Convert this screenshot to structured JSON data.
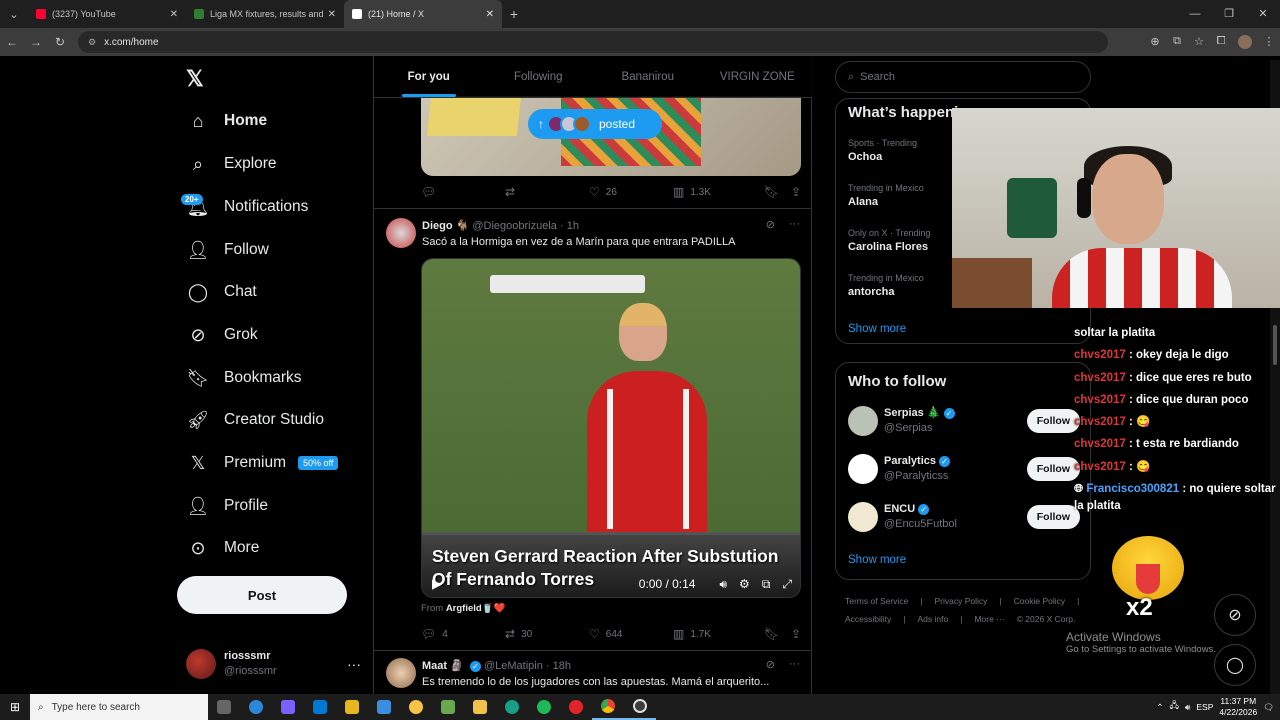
{
  "browser": {
    "tabs": [
      {
        "title": "(3237) YouTube",
        "favicon_color": "#ff0033",
        "active": false
      },
      {
        "title": "Liga MX fixtures, results and live",
        "favicon_color": "#2e7d32",
        "active": false
      },
      {
        "title": "(21) Home / X",
        "favicon_color": "#ffffff",
        "active": true
      }
    ],
    "url": "x.com/home",
    "new_tab_symbol": "+"
  },
  "nav": {
    "items": [
      {
        "label": "Home",
        "icon": "home-icon",
        "bold": true
      },
      {
        "label": "Explore",
        "icon": "search-icon"
      },
      {
        "label": "Notifications",
        "icon": "bell-icon"
      },
      {
        "label": "Follow",
        "icon": "follow-icon"
      },
      {
        "label": "Chat",
        "icon": "chat-icon"
      },
      {
        "label": "Grok",
        "icon": "grok-icon"
      },
      {
        "label": "Bookmarks",
        "icon": "bookmark-icon"
      },
      {
        "label": "Creator Studio",
        "icon": "rocket-icon"
      },
      {
        "label": "Premium",
        "icon": "x-logo-icon"
      },
      {
        "label": "Profile",
        "icon": "person-icon"
      },
      {
        "label": "More",
        "icon": "more-circle-icon"
      }
    ],
    "notifications_badge": "20+",
    "premium_badge": "50% off",
    "post_label": "Post",
    "account": {
      "name": "riosssmr",
      "handle": "@riosssmr"
    }
  },
  "timeline": {
    "tabs": [
      "For you",
      "Following",
      "Bananirou",
      "VIRGIN ZONE"
    ],
    "posted_pill": "posted",
    "tweet1": {
      "replies": "",
      "retweets": "",
      "likes": "26",
      "views": "1.3K"
    },
    "tweet2": {
      "name": "Diego 🐐",
      "handle": "@Diegoobrizuela",
      "time": "· 1h",
      "text": "Sacó a la Hormiga en vez de a Marín para que entrara PADILLA",
      "video_caption": "Steven Gerrard Reaction After Substution Of Fernando Torres",
      "video_time": "0:00 / 0:14",
      "from_label": "From",
      "from_account": "Argfield🥤❤️",
      "replies": "4",
      "retweets": "30",
      "likes": "644",
      "views": "1.7K"
    },
    "tweet3": {
      "name": "Maat 🗿",
      "handle": "@LeMatipin",
      "time": "· 18h",
      "text": "Es tremendo lo de los jugadores con las apuestas. Mamá el arquerito..."
    }
  },
  "right": {
    "search_placeholder": "Search",
    "happening_title": "What’s happening",
    "trends": [
      {
        "category": "Sports · Trending",
        "title": "Ochoa"
      },
      {
        "category": "Trending in Mexico",
        "title": "Alana"
      },
      {
        "category": "Only on X · Trending",
        "title": "Carolina Flores"
      },
      {
        "category": "Trending in Mexico",
        "title": "antorcha"
      }
    ],
    "show_more": "Show more",
    "who_to_follow_title": "Who to follow",
    "who_to_follow": [
      {
        "name": "Serpias 🎄",
        "handle": "@Serpias",
        "avatar_color": "#b9c2b4"
      },
      {
        "name": "Paralytics",
        "handle": "@Paralyticss",
        "avatar_color": "#ffffff"
      },
      {
        "name": "ENCU",
        "handle": "@Encu5Futbol",
        "avatar_color": "#f0e8d0"
      }
    ],
    "follow_label": "Follow",
    "footer": [
      "Terms of Service",
      "|",
      "Privacy Policy",
      "|",
      "Cookie Policy",
      "|",
      "Accessibility",
      "|",
      "Ads info",
      "|",
      "More ···",
      "© 2026 X Corp."
    ]
  },
  "overlay": {
    "chat": [
      {
        "user": "",
        "msg": "soltar la platita"
      },
      {
        "user": "chvs2017",
        "msg": ": okey deja le digo"
      },
      {
        "user": "chvs2017",
        "msg": ": dice que eres re buto"
      },
      {
        "user": "chvs2017",
        "msg": ": dice que duran poco"
      },
      {
        "user": "chvs2017",
        "msg": ": 😋"
      },
      {
        "user": "chvs2017",
        "msg": ": t esta re bardiando"
      },
      {
        "user": "chvs2017",
        "msg": ": 😋"
      },
      {
        "user": "Francisco300821",
        "msg": ": no quiere soltar la platita",
        "alt": true
      }
    ],
    "emoji_multiplier": "x2",
    "activate_line1": "Activate Windows",
    "activate_line2": "Go to Settings to activate Windows."
  },
  "taskbar": {
    "search_placeholder": "Type here to search",
    "language": "ESP",
    "time": "11:37 PM",
    "date": "4/22/2026",
    "apps": [
      "#2b88d8",
      "#0f9d58",
      "#e6b81f",
      "#0078d4",
      "#107c10",
      "#5c6bc0",
      "#6aa84f",
      "#f6c343",
      "#17a085",
      "#1db954",
      "#e0242a",
      "#3c3c3c",
      "#888888"
    ]
  }
}
